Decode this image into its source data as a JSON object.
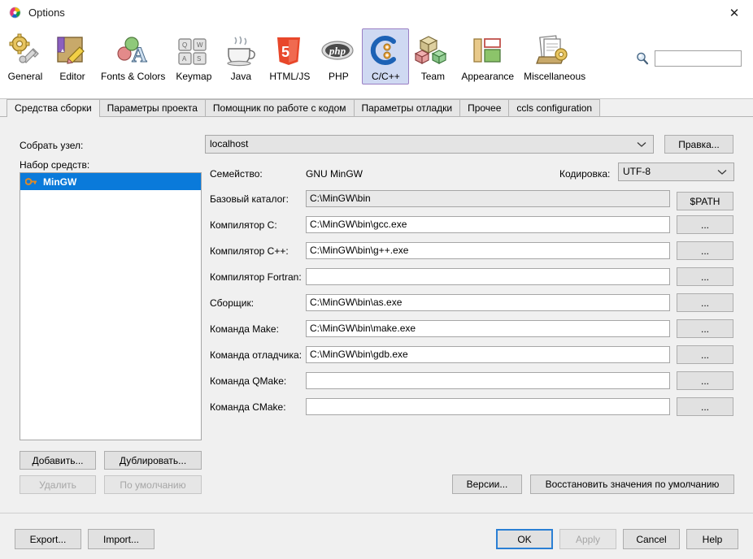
{
  "window": {
    "title": "Options",
    "app_icon": "netbeans-logo-icon",
    "close_label": "✕"
  },
  "toolbar": {
    "categories": [
      {
        "id": "general",
        "label": "General",
        "icon": "gear-wrench-icon",
        "selected": false
      },
      {
        "id": "editor",
        "label": "Editor",
        "icon": "book-pencil-icon",
        "selected": false
      },
      {
        "id": "fonts-colors",
        "label": "Fonts & Colors",
        "icon": "font-palette-icon",
        "selected": false
      },
      {
        "id": "keymap",
        "label": "Keymap",
        "icon": "keyboard-keys-icon",
        "selected": false
      },
      {
        "id": "java",
        "label": "Java",
        "icon": "coffee-cup-icon",
        "selected": false
      },
      {
        "id": "html-js",
        "label": "HTML/JS",
        "icon": "html5-shield-icon",
        "selected": false
      },
      {
        "id": "php",
        "label": "PHP",
        "icon": "php-elephant-icon",
        "selected": false
      },
      {
        "id": "c-cpp",
        "label": "C/C++",
        "icon": "c-plus-plus-icon",
        "selected": true
      },
      {
        "id": "team",
        "label": "Team",
        "icon": "cubes-icon",
        "selected": false
      },
      {
        "id": "appearance",
        "label": "Appearance",
        "icon": "layout-panes-icon",
        "selected": false
      },
      {
        "id": "miscellaneous",
        "label": "Miscellaneous",
        "icon": "papers-gear-icon",
        "selected": false
      }
    ]
  },
  "search": {
    "icon": "search-magnifier-icon",
    "value": "",
    "placeholder": ""
  },
  "tabs": [
    {
      "id": "build-tools",
      "label": "Средства сборки",
      "active": true
    },
    {
      "id": "project-params",
      "label": "Параметры проекта",
      "active": false
    },
    {
      "id": "code-assistant",
      "label": "Помощник по работе с кодом",
      "active": false
    },
    {
      "id": "debug-params",
      "label": "Параметры отладки",
      "active": false
    },
    {
      "id": "other",
      "label": "Прочее",
      "active": false
    },
    {
      "id": "ccls-config",
      "label": "ccls configuration",
      "active": false
    }
  ],
  "left_panel": {
    "host_label": "Собрать узел:",
    "toolset_label": "Набор средств:",
    "toolsets": [
      {
        "label": "MinGW",
        "icon": "key-icon",
        "selected": true
      }
    ],
    "buttons": {
      "add": "Добавить...",
      "duplicate": "Дублировать...",
      "delete": "Удалить",
      "default": "По умолчанию"
    }
  },
  "form": {
    "host_combo_value": "localhost",
    "edit_button": "Правка...",
    "family_label": "Семейство:",
    "family_value": "GNU MinGW",
    "encoding_label": "Кодировка:",
    "encoding_value": "UTF-8",
    "path_button": "$PATH",
    "dots_button": "...",
    "rows": [
      {
        "id": "base-directory",
        "label": "Базовый каталог:",
        "value": "C:\\MinGW\\bin",
        "readonly": true
      },
      {
        "id": "c-compiler",
        "label": "Компилятор C:",
        "value": "C:\\MinGW\\bin\\gcc.exe",
        "readonly": false
      },
      {
        "id": "cpp-compiler",
        "label": "Компилятор C++:",
        "value": "C:\\MinGW\\bin\\g++.exe",
        "readonly": false
      },
      {
        "id": "fortran-compiler",
        "label": "Компилятор Fortran:",
        "value": "",
        "readonly": false
      },
      {
        "id": "assembler",
        "label": "Сборщик:",
        "value": "C:\\MinGW\\bin\\as.exe",
        "readonly": false
      },
      {
        "id": "make-command",
        "label": "Команда Make:",
        "value": "C:\\MinGW\\bin\\make.exe",
        "readonly": false
      },
      {
        "id": "debugger-command",
        "label": "Команда отладчика:",
        "value": "C:\\MinGW\\bin\\gdb.exe",
        "readonly": false
      },
      {
        "id": "qmake-command",
        "label": "Команда QMake:",
        "value": "",
        "readonly": false
      },
      {
        "id": "cmake-command",
        "label": "Команда CMake:",
        "value": "",
        "readonly": false
      }
    ],
    "versions_button": "Версии...",
    "restore_defaults_button": "Восстановить значения по умолчанию"
  },
  "footer": {
    "export": "Export...",
    "import": "Import...",
    "ok": "OK",
    "apply": "Apply",
    "cancel": "Cancel",
    "help": "Help"
  },
  "colors": {
    "selection_blue": "#0a7ada",
    "focus_blue": "#2a7fd4",
    "panel_bg": "#f0f0f0",
    "field_bg": "#ffffff",
    "readonly_bg": "#e9e9e9",
    "selected_category_bg": "#cfd9f2",
    "selected_category_border": "#9a7fc4"
  }
}
